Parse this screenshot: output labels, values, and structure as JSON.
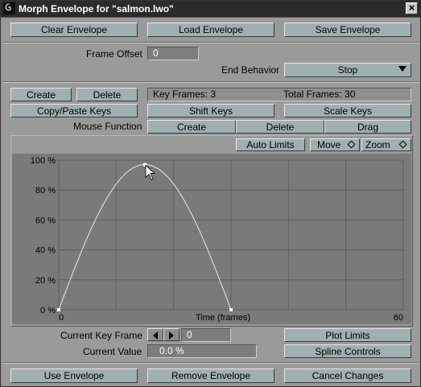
{
  "window": {
    "title": "Morph Envelope for \"salmon.lwo\"",
    "close_label": "×"
  },
  "top_buttons": {
    "clear": "Clear Envelope",
    "load": "Load Envelope",
    "save": "Save Envelope"
  },
  "frame_offset": {
    "label": "Frame Offset",
    "value": "0"
  },
  "end_behavior": {
    "label": "End Behavior",
    "value": "Stop"
  },
  "keys": {
    "create": "Create",
    "delete": "Delete",
    "key_frames": "Key Frames: 3",
    "total_frames": "Total Frames: 30",
    "copy_paste": "Copy/Paste Keys",
    "shift": "Shift Keys",
    "scale": "Scale Keys"
  },
  "mouse_function": {
    "label": "Mouse Function",
    "options": [
      "Create",
      "Delete",
      "Drag"
    ]
  },
  "graph_controls": {
    "auto_limits": "Auto Limits",
    "move": "Move",
    "zoom": "Zoom"
  },
  "chart_data": {
    "type": "line",
    "xlabel": "Time (frames)",
    "ylabel": "",
    "xlim": [
      0,
      60
    ],
    "ylim": [
      0,
      100
    ],
    "y_ticks": [
      "0 %",
      "20 %",
      "40 %",
      "60 %",
      "80 %",
      "100 %"
    ],
    "x_ticks": [
      "0",
      "60"
    ],
    "grid": true,
    "keyframes": [
      {
        "x": 0,
        "y": 0
      },
      {
        "x": 15,
        "y": 97
      },
      {
        "x": 30,
        "y": 0
      }
    ]
  },
  "current_key_frame": {
    "label": "Current Key Frame",
    "value": "0"
  },
  "current_value": {
    "label": "Current Value",
    "value": "0.0 %"
  },
  "side_buttons": {
    "plot_limits": "Plot Limits",
    "spline_controls": "Spline Controls"
  },
  "bottom_buttons": {
    "use": "Use Envelope",
    "remove": "Remove Envelope",
    "cancel": "Cancel Changes"
  }
}
